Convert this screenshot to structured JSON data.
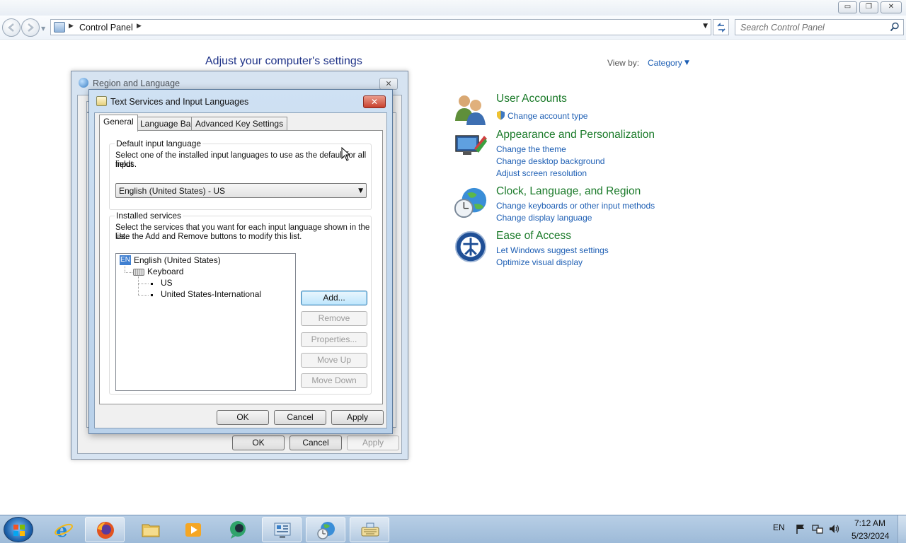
{
  "window": {
    "minimize_glyph": "▭",
    "restore_glyph": "❐",
    "close_glyph": "✕"
  },
  "address_bar": {
    "path": "Control Panel",
    "search_placeholder": "Search Control Panel"
  },
  "control_panel": {
    "heading": "Adjust your computer's settings",
    "view_by_label": "View by:",
    "view_by_value": "Category",
    "categories": [
      {
        "title": "User Accounts",
        "icon": "users-icon",
        "links": [
          "Change account type"
        ]
      },
      {
        "title": "Appearance and Personalization",
        "icon": "appearance-icon",
        "links": [
          "Change the theme",
          "Change desktop background",
          "Adjust screen resolution"
        ]
      },
      {
        "title": "Clock, Language, and Region",
        "icon": "clock-globe-icon",
        "links": [
          "Change keyboards or other input methods",
          "Change display language"
        ]
      },
      {
        "title": "Ease of Access",
        "icon": "ease-of-access-icon",
        "links": [
          "Let Windows suggest settings",
          "Optimize visual display"
        ]
      }
    ]
  },
  "region_dialog": {
    "title": "Region and Language",
    "ok": "OK",
    "cancel": "Cancel",
    "apply": "Apply"
  },
  "text_services_dialog": {
    "title": "Text Services and Input Languages",
    "tabs": [
      "General",
      "Language Bar",
      "Advanced Key Settings"
    ],
    "active_tab": "General",
    "default_input": {
      "legend": "Default input language",
      "description_line1": "Select one of the installed input languages to use as the default for all input",
      "description_line2": "fields.",
      "selected": "English (United States) - US"
    },
    "installed_services": {
      "legend": "Installed services",
      "description_line1": "Select the services that you want for each input language shown in the list.",
      "description_line2": "Use the Add and Remove buttons to modify this list.",
      "tree": {
        "language_code": "EN",
        "language": "English (United States)",
        "category": "Keyboard",
        "layouts": [
          "US",
          "United States-International"
        ]
      },
      "buttons": {
        "add": "Add...",
        "remove": "Remove",
        "properties": "Properties...",
        "move_up": "Move Up",
        "move_down": "Move Down"
      }
    },
    "footer": {
      "ok": "OK",
      "cancel": "Cancel",
      "apply": "Apply"
    }
  },
  "taskbar": {
    "pinned": [
      "start-button",
      "internet-explorer",
      "firefox",
      "file-explorer",
      "media-player",
      "app-green",
      "control-panel",
      "region-language",
      "keyboard"
    ],
    "tray_language": "EN",
    "time": "7:12 AM",
    "date": "5/23/2024"
  }
}
